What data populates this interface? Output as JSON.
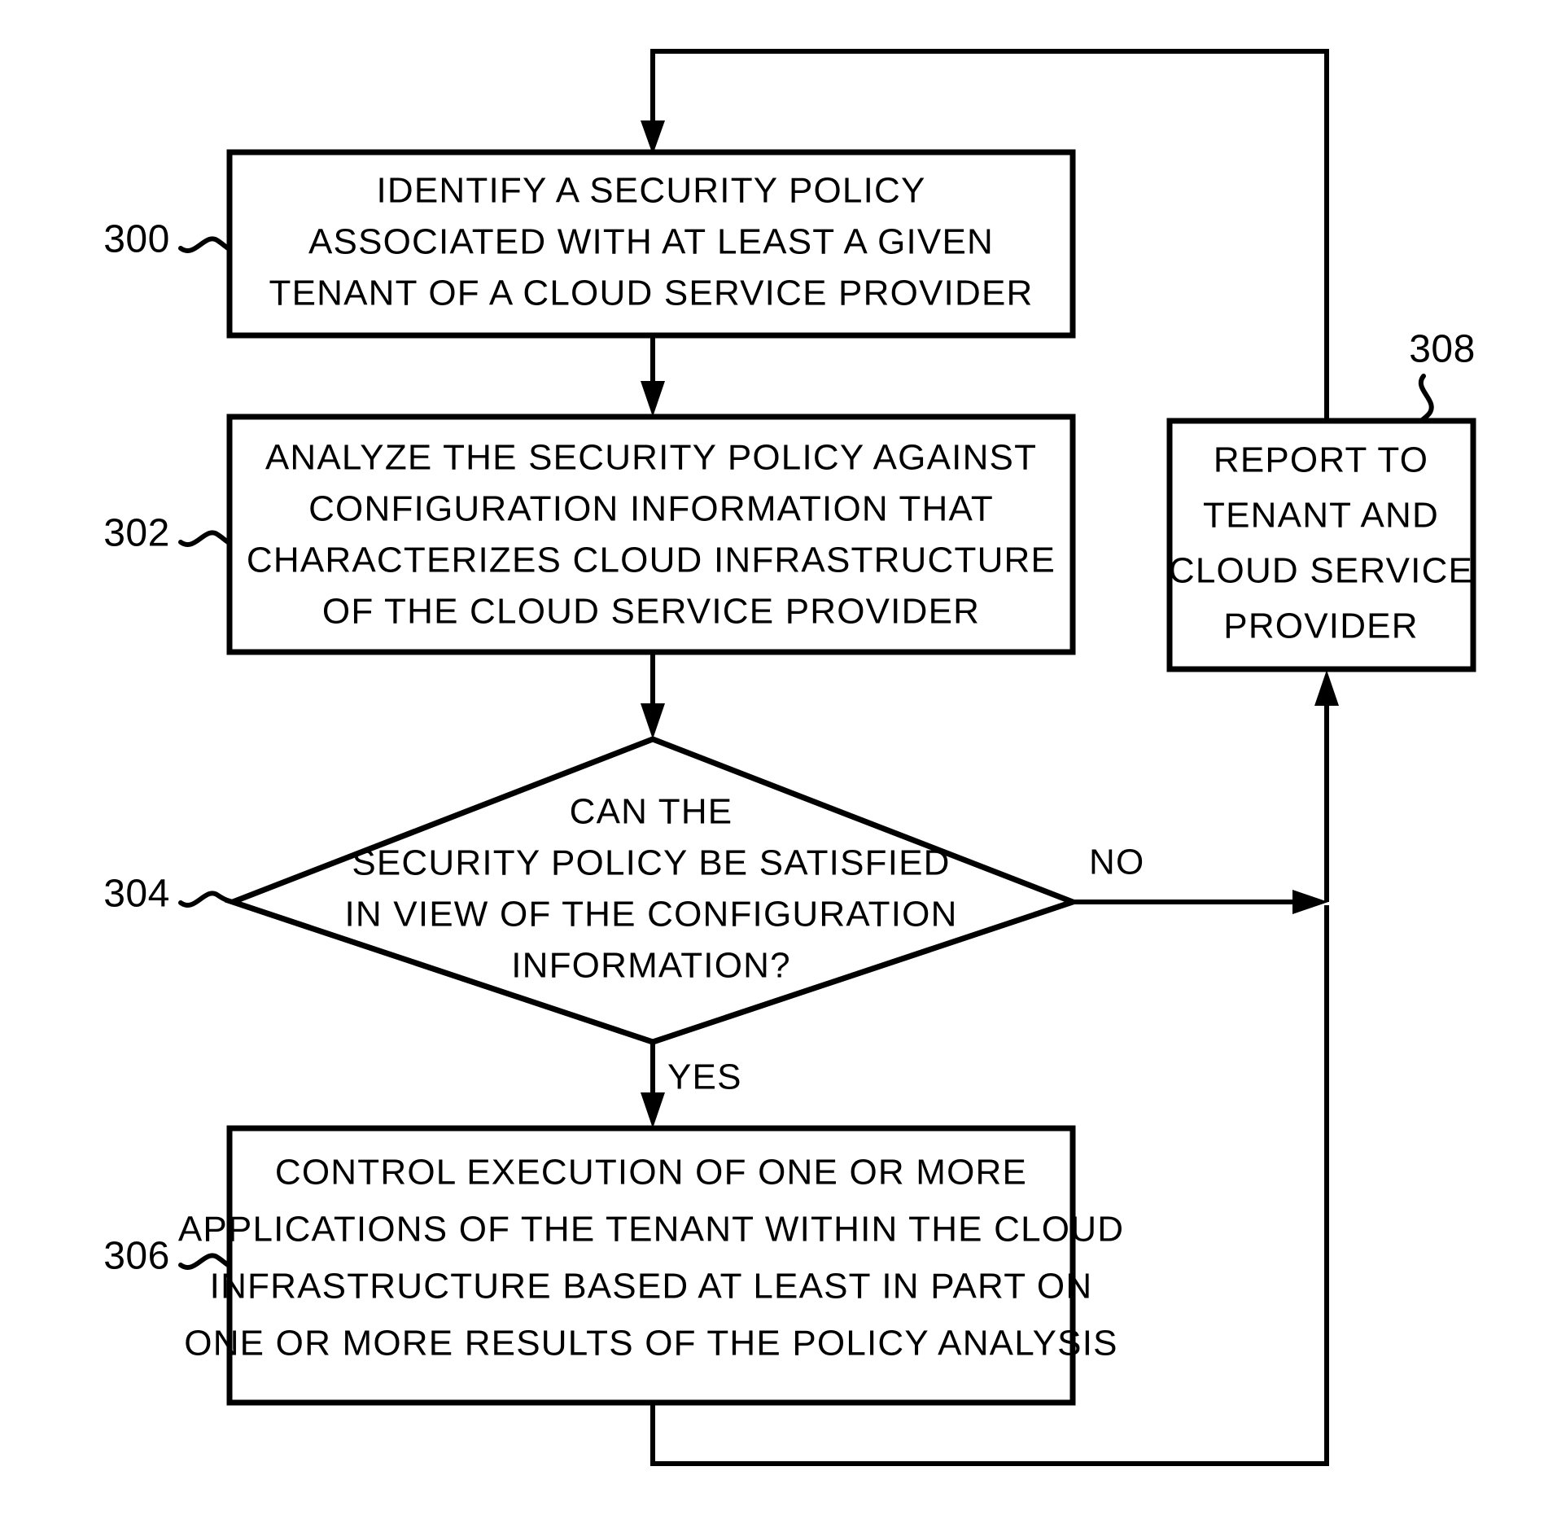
{
  "figure": {
    "title": "Security policy analysis flowchart",
    "background_color": "#ffffff",
    "line_color": "#000000"
  },
  "nodes": {
    "step_300": {
      "ref": "300",
      "type": "process",
      "lines": [
        "IDENTIFY A SECURITY POLICY",
        "ASSOCIATED WITH AT LEAST A GIVEN",
        "TENANT OF A CLOUD SERVICE PROVIDER"
      ]
    },
    "step_302": {
      "ref": "302",
      "type": "process",
      "lines": [
        "ANALYZE THE SECURITY POLICY AGAINST",
        "CONFIGURATION INFORMATION THAT",
        "CHARACTERIZES CLOUD INFRASTRUCTURE",
        "OF THE CLOUD SERVICE PROVIDER"
      ]
    },
    "step_304": {
      "ref": "304",
      "type": "decision",
      "lines": [
        "CAN THE",
        "SECURITY POLICY BE SATISFIED",
        "IN VIEW OF THE CONFIGURATION",
        "INFORMATION?"
      ]
    },
    "step_306": {
      "ref": "306",
      "type": "process",
      "lines": [
        "CONTROL EXECUTION OF ONE OR MORE",
        "APPLICATIONS OF THE TENANT WITHIN THE CLOUD",
        "INFRASTRUCTURE BASED AT LEAST IN PART ON",
        "ONE OR MORE RESULTS OF THE POLICY ANALYSIS"
      ]
    },
    "step_308": {
      "ref": "308",
      "type": "process",
      "lines": [
        "REPORT TO",
        "TENANT AND",
        "CLOUD SERVICE",
        "PROVIDER"
      ]
    }
  },
  "branch_labels": {
    "no": "NO",
    "yes": "YES"
  }
}
